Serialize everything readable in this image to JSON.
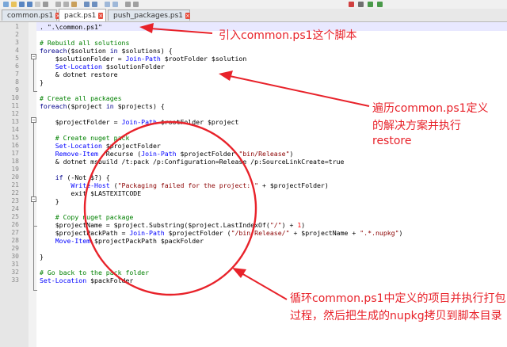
{
  "tabs": [
    {
      "label": "common.ps1"
    },
    {
      "label": "pack.ps1",
      "active": true
    },
    {
      "label": "push_packages.ps1"
    }
  ],
  "code_lines": [
    {
      "n": "1",
      "parts": [
        [
          "var",
          ". \".\\common.ps1\""
        ]
      ]
    },
    {
      "n": "2",
      "parts": []
    },
    {
      "n": "3",
      "parts": [
        [
          "cm",
          "# Rebuild all solutions"
        ]
      ]
    },
    {
      "n": "4",
      "parts": [
        [
          "kw",
          "foreach"
        ],
        [
          "var",
          "($solution "
        ],
        [
          "kw",
          "in"
        ],
        [
          "var",
          " $solutions) {"
        ]
      ]
    },
    {
      "n": "5",
      "parts": [
        [
          "var",
          "    $solutionFolder = "
        ],
        [
          "cmd",
          "Join-Path"
        ],
        [
          "var",
          " $rootFolder $solution"
        ]
      ]
    },
    {
      "n": "6",
      "parts": [
        [
          "cmd",
          "    Set-Location"
        ],
        [
          "var",
          " $solutionFolder"
        ]
      ]
    },
    {
      "n": "7",
      "parts": [
        [
          "var",
          "    & dotnet restore"
        ]
      ]
    },
    {
      "n": "8",
      "parts": [
        [
          "var",
          "}"
        ]
      ]
    },
    {
      "n": "9",
      "parts": []
    },
    {
      "n": "10",
      "parts": [
        [
          "cm",
          "# Create all packages"
        ]
      ]
    },
    {
      "n": "11",
      "parts": [
        [
          "kw",
          "foreach"
        ],
        [
          "var",
          "($project "
        ],
        [
          "kw",
          "in"
        ],
        [
          "var",
          " $projects) {"
        ]
      ]
    },
    {
      "n": "12",
      "parts": []
    },
    {
      "n": "13",
      "parts": [
        [
          "var",
          "    $projectFolder = "
        ],
        [
          "cmd",
          "Join-Path"
        ],
        [
          "var",
          " $rootFolder $project"
        ]
      ]
    },
    {
      "n": "14",
      "parts": []
    },
    {
      "n": "15",
      "parts": [
        [
          "cm",
          "    # Create nuget pack"
        ]
      ]
    },
    {
      "n": "16",
      "parts": [
        [
          "cmd",
          "    Set-Location"
        ],
        [
          "var",
          " $projectFolder"
        ]
      ]
    },
    {
      "n": "17",
      "parts": [
        [
          "cmd",
          "    Remove-Item"
        ],
        [
          "var",
          " -Recurse ("
        ],
        [
          "cmd",
          "Join-Path"
        ],
        [
          "var",
          " $projectFolder "
        ],
        [
          "str",
          "\"bin/Release\""
        ],
        [
          "var",
          ")"
        ]
      ]
    },
    {
      "n": "18",
      "parts": [
        [
          "var",
          "    & dotnet msbuild /t:pack /p:Configuration=Release /p:SourceLinkCreate=true"
        ]
      ]
    },
    {
      "n": "19",
      "parts": []
    },
    {
      "n": "20",
      "parts": [
        [
          "kw",
          "    if"
        ],
        [
          "var",
          " (-Not $?) {"
        ]
      ]
    },
    {
      "n": "21",
      "parts": [
        [
          "cmd",
          "        Write-Host"
        ],
        [
          "var",
          " ("
        ],
        [
          "str",
          "\"Packaging failed for the project: \""
        ],
        [
          "var",
          " + $projectFolder)"
        ]
      ]
    },
    {
      "n": "22",
      "parts": [
        [
          "var",
          "        exit $LASTEXITCODE"
        ]
      ]
    },
    {
      "n": "23",
      "parts": [
        [
          "var",
          "    }"
        ]
      ]
    },
    {
      "n": "24",
      "parts": []
    },
    {
      "n": "25",
      "parts": [
        [
          "cm",
          "    # Copy nuget package"
        ]
      ]
    },
    {
      "n": "26",
      "parts": [
        [
          "var",
          "    $projectName = $project.Substring($project.LastIndexOf("
        ],
        [
          "str",
          "\"/\""
        ],
        [
          "var",
          ") + "
        ],
        [
          "num",
          "1"
        ],
        [
          "var",
          ")"
        ]
      ]
    },
    {
      "n": "27",
      "parts": [
        [
          "var",
          "    $projectPackPath = "
        ],
        [
          "cmd",
          "Join-Path"
        ],
        [
          "var",
          " $projectFolder ("
        ],
        [
          "str",
          "\"/bin/Release/\""
        ],
        [
          "var",
          " + $projectName + "
        ],
        [
          "str",
          "\".*.nupkg\""
        ],
        [
          "var",
          ")"
        ]
      ]
    },
    {
      "n": "28",
      "parts": [
        [
          "cmd",
          "    Move-Item"
        ],
        [
          "var",
          " $projectPackPath $packFolder"
        ]
      ]
    },
    {
      "n": "29",
      "parts": []
    },
    {
      "n": "30",
      "parts": [
        [
          "var",
          "}"
        ]
      ]
    },
    {
      "n": "31",
      "parts": []
    },
    {
      "n": "32",
      "parts": [
        [
          "cm",
          "# Go back to the pack folder"
        ]
      ]
    },
    {
      "n": "33",
      "parts": [
        [
          "cmd",
          "Set-Location"
        ],
        [
          "var",
          " $packFolder"
        ]
      ]
    }
  ],
  "annotations": {
    "a1": "引入common.ps1这个脚本",
    "a2_l1": "遍历common.ps1定义",
    "a2_l2": "的解决方案并执行",
    "a2_l3": "restore",
    "a3_l1": "循环common.ps1中定义的项目并执行打包",
    "a3_l2": "过程，然后把生成的nupkg拷贝到脚本目录"
  },
  "colors": {
    "annotation": "#e8222a",
    "comment": "#008000",
    "keyword": "#00008b",
    "cmdlet": "#0000ff",
    "string": "#8b0000"
  }
}
